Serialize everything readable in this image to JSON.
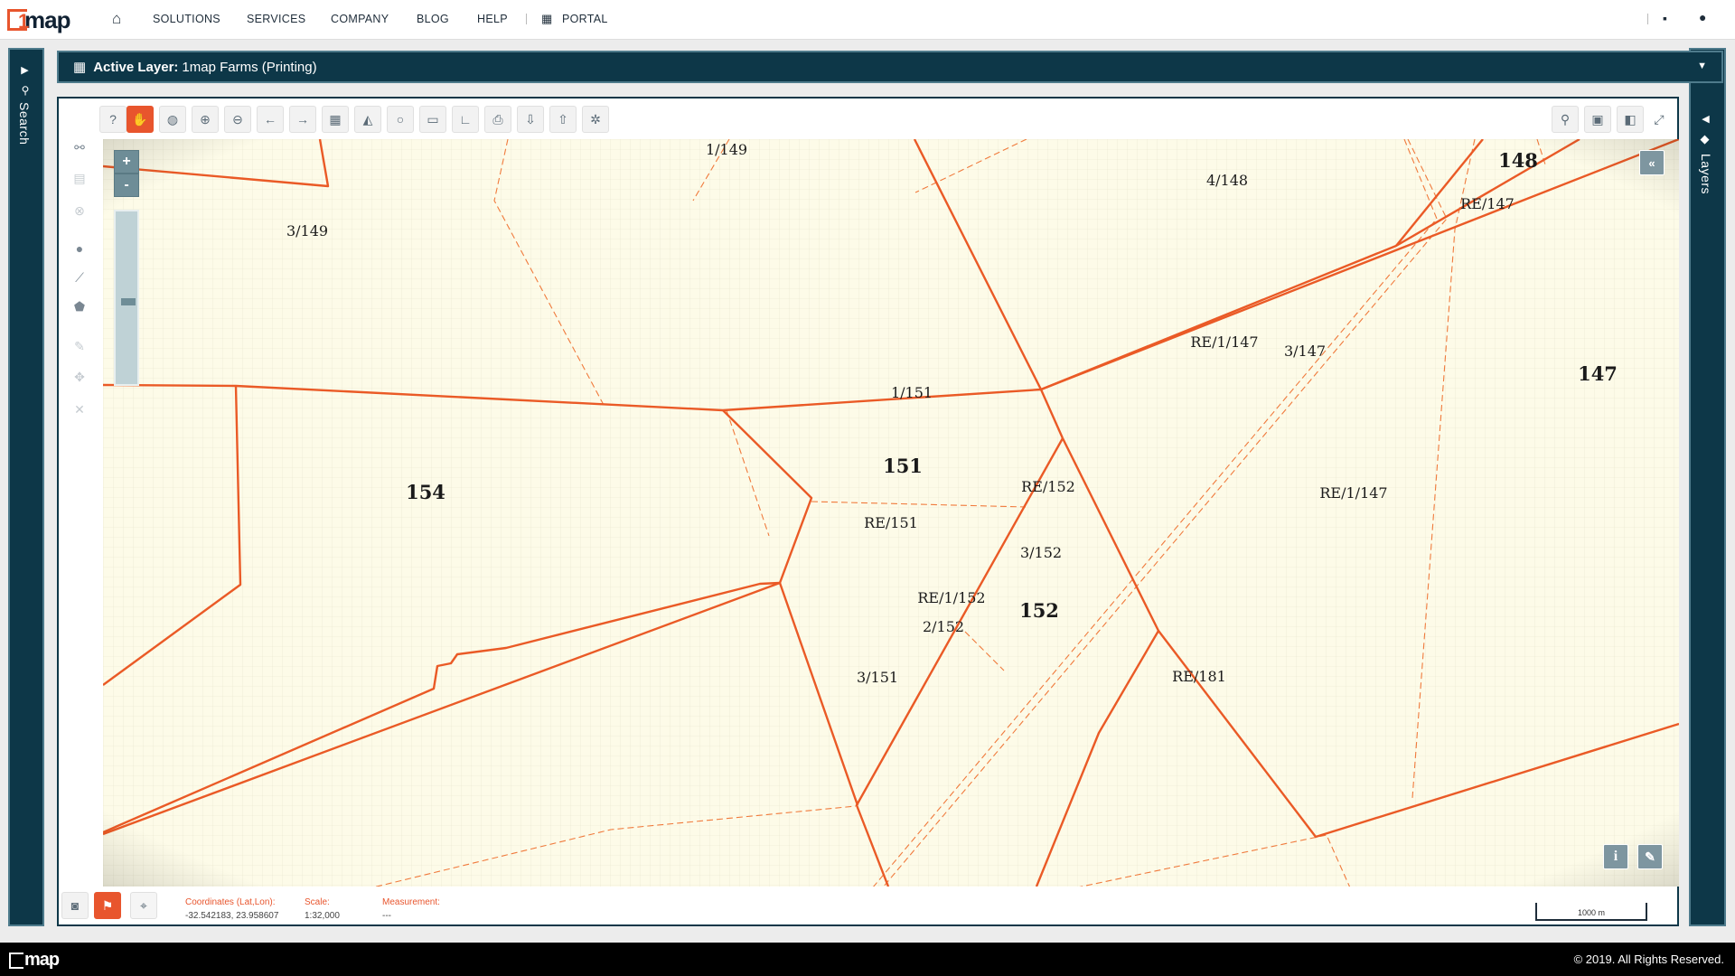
{
  "brand": {
    "name": "map",
    "badge": "1",
    "accent": "#e8552d",
    "dark": "#0d3748"
  },
  "nav": {
    "items": [
      "SOLUTIONS",
      "SERVICES",
      "COMPANY",
      "BLOG",
      "HELP"
    ],
    "portal": "PORTAL"
  },
  "left_panel": {
    "label": "Search"
  },
  "right_panel": {
    "label": "Layers"
  },
  "layer_bar": {
    "prefix": "Active Layer:",
    "name": "1map Farms (Printing)"
  },
  "map": {
    "zoom_in": "+",
    "zoom_out": "-",
    "zoom_level": 0.45,
    "labels": [
      {
        "text": "1/149",
        "bold": false
      },
      {
        "text": "4/148",
        "bold": false
      },
      {
        "text": "148",
        "bold": true
      },
      {
        "text": "RE/147",
        "bold": false
      },
      {
        "text": "3/149",
        "bold": false
      },
      {
        "text": "RE/1/147",
        "bold": false
      },
      {
        "text": "3/147",
        "bold": false
      },
      {
        "text": "147",
        "bold": true
      },
      {
        "text": "1/151",
        "bold": false
      },
      {
        "text": "151",
        "bold": true
      },
      {
        "text": "154",
        "bold": true
      },
      {
        "text": "RE/152",
        "bold": false
      },
      {
        "text": "RE/1/147",
        "bold": false
      },
      {
        "text": "RE/151",
        "bold": false
      },
      {
        "text": "3/152",
        "bold": false
      },
      {
        "text": "RE/1/152",
        "bold": false
      },
      {
        "text": "152",
        "bold": true
      },
      {
        "text": "2/152",
        "bold": false
      },
      {
        "text": "3/151",
        "bold": false
      },
      {
        "text": "RE/181",
        "bold": false
      }
    ]
  },
  "status": {
    "coords_label": "Coordinates (Lat,Lon):",
    "coords_value": "-32.542183, 23.958607",
    "scale_label": "Scale:",
    "scale_value": "1:32,000",
    "measure_label": "Measurement:",
    "measure_value": "---",
    "scalebar": "1000 m"
  },
  "footer": {
    "brand": "map",
    "copyright": "© 2019. All Rights Reserved."
  }
}
